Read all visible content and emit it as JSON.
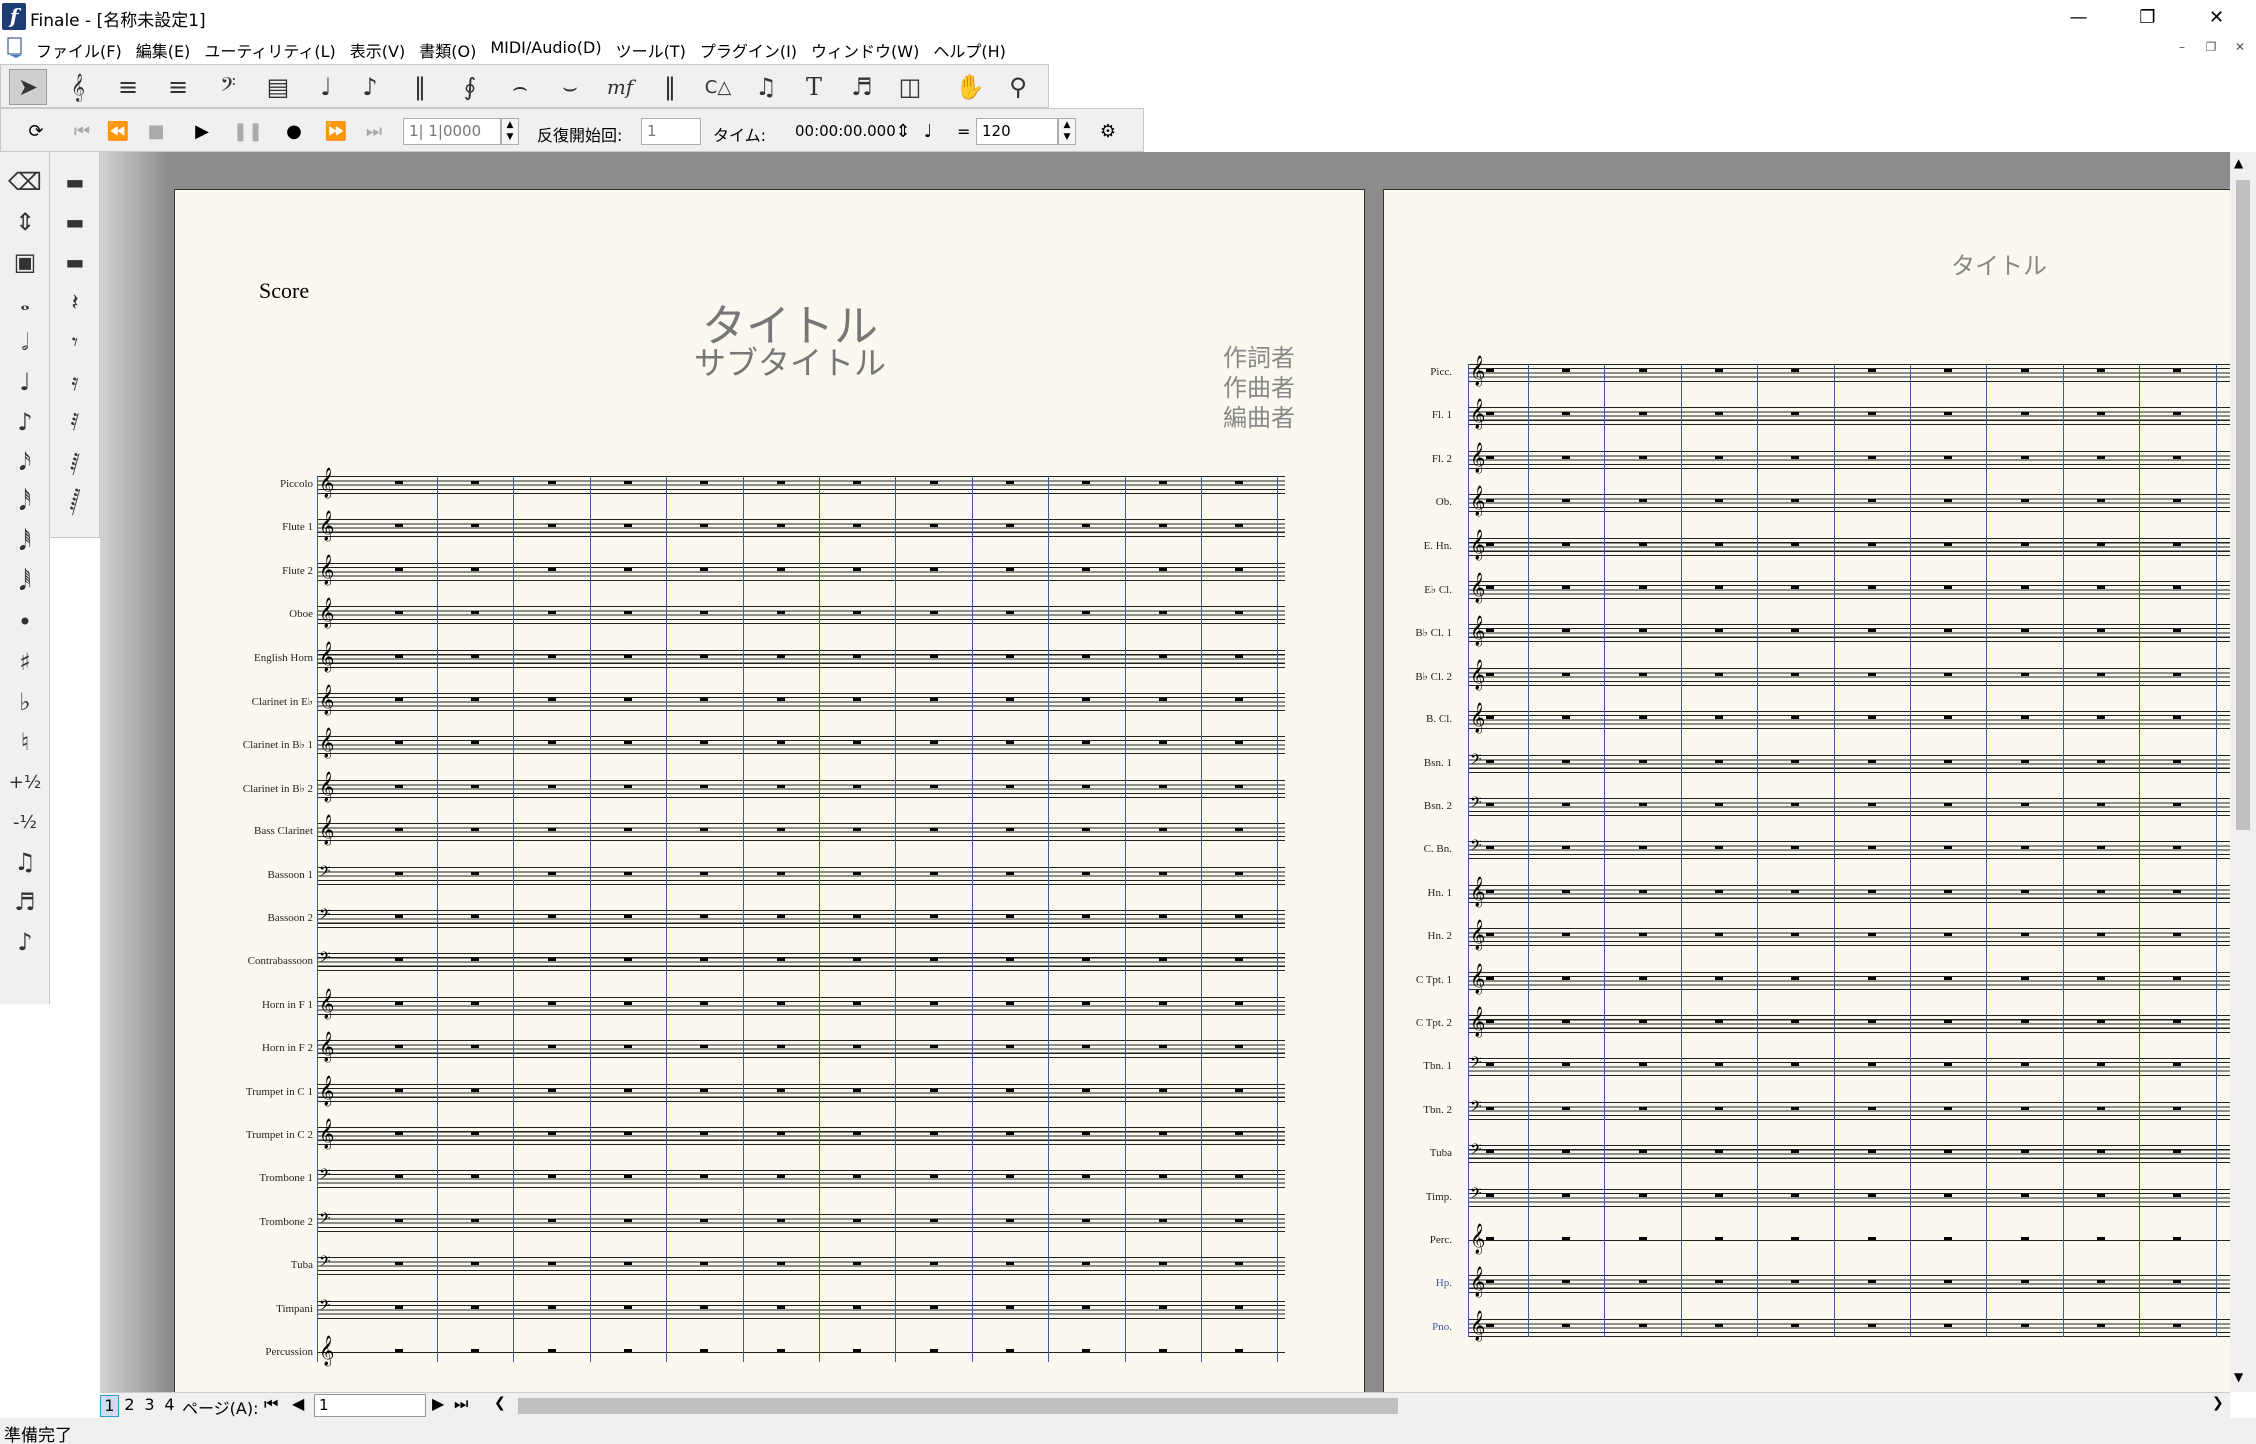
{
  "window": {
    "title": "Finale - [名称未設定1]",
    "icon": "f"
  },
  "menu": [
    "ファイル(F)",
    "編集(E)",
    "ユーティリティ(L)",
    "表示(V)",
    "書類(O)",
    "MIDI/Audio(D)",
    "ツール(T)",
    "プラグイン(I)",
    "ウィンドウ(W)",
    "ヘルプ(H)"
  ],
  "transport": {
    "measure_value": "1| 1|0000",
    "repeat_label": "反復開始回:",
    "repeat_value": "1",
    "time_label": "タイム:",
    "time_value": "00:00:00.000",
    "tempo_eq": "=",
    "tempo_value": "120"
  },
  "score": {
    "page_label": "Score",
    "title": "タイトル",
    "subtitle": "サブタイトル",
    "lyricist": "作詞者",
    "composer": "作曲者",
    "arranger": "編曲者",
    "page2_title": "タイトル",
    "page1_instruments": [
      "Piccolo",
      "Flute 1",
      "Flute 2",
      "Oboe",
      "English Horn",
      "Clarinet in E♭",
      "Clarinet in B♭ 1",
      "Clarinet in B♭ 2",
      "Bass Clarinet",
      "Bassoon 1",
      "Bassoon 2",
      "Contrabassoon",
      "Horn in F 1",
      "Horn in F 2",
      "Trumpet in C 1",
      "Trumpet in C 2",
      "Trombone 1",
      "Trombone 2",
      "Tuba",
      "Timpani",
      "Percussion"
    ],
    "page2_instruments": [
      "Picc.",
      "Fl. 1",
      "Fl. 2",
      "Ob.",
      "E. Hn.",
      "E♭ Cl.",
      "B♭ Cl. 1",
      "B♭ Cl. 2",
      "B. Cl.",
      "Bsn. 1",
      "Bsn. 2",
      "C. Bn.",
      "Hn. 1",
      "Hn. 2",
      "C Tpt. 1",
      "C Tpt. 2",
      "Tbn. 1",
      "Tbn. 2",
      "Tuba",
      "Timp.",
      "Perc.",
      "Hp.",
      "Pno."
    ]
  },
  "page_nav": {
    "tabs": [
      "1",
      "2",
      "3",
      "4"
    ],
    "label": "ページ(A):",
    "value": "1"
  },
  "status": "準備完了"
}
